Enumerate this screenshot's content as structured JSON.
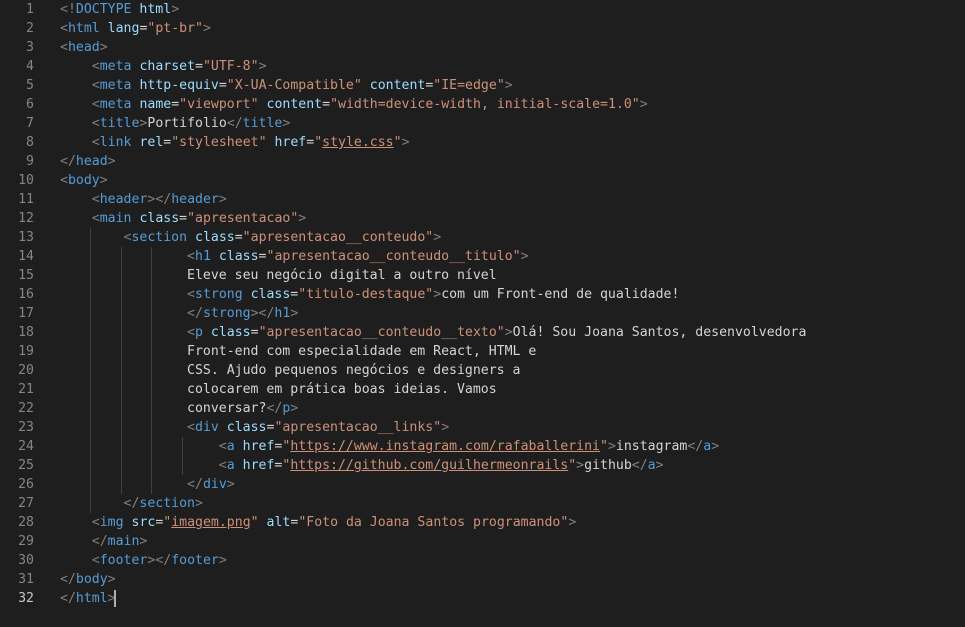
{
  "editor": {
    "active_line": 32,
    "lines": [
      "<!DOCTYPE html>",
      "<html lang=\"pt-br\">",
      "<head>",
      "    <meta charset=\"UTF-8\">",
      "    <meta http-equiv=\"X-UA-Compatible\" content=\"IE=edge\">",
      "    <meta name=\"viewport\" content=\"width=device-width, initial-scale=1.0\">",
      "    <title>Portifolio</title>",
      "    <link rel=\"stylesheet\" href=\"style.css\">",
      "</head>",
      "<body>",
      "    <header></header>",
      "    <main class=\"apresentacao\">",
      "        <section class=\"apresentacao__conteudo\">",
      "                <h1 class=\"apresentacao__conteudo__titulo\">",
      "                Eleve seu negócio digital a outro nível",
      "                <strong class=\"titulo-destaque\">com um Front-end de qualidade!",
      "                </strong></h1>",
      "                <p class=\"apresentacao__conteudo__texto\">Olá! Sou Joana Santos, desenvolvedora",
      "                Front-end com especialidade em React, HTML e",
      "                CSS. Ajudo pequenos negócios e designers a",
      "                colocarem em prática boas ideias. Vamos",
      "                conversar?</p>",
      "                <div class=\"apresentacao__links\">",
      "                    <a href=\"https://www.instagram.com/rafaballerini\">instagram</a>",
      "                    <a href=\"https://github.com/guilhermeonrails\">github</a>",
      "                </div>",
      "        </section>",
      "    <img src=\"imagem.png\" alt=\"Foto da Joana Santos programando\">",
      "    </main>",
      "    <footer></footer>",
      "</body>",
      "</html>"
    ]
  }
}
